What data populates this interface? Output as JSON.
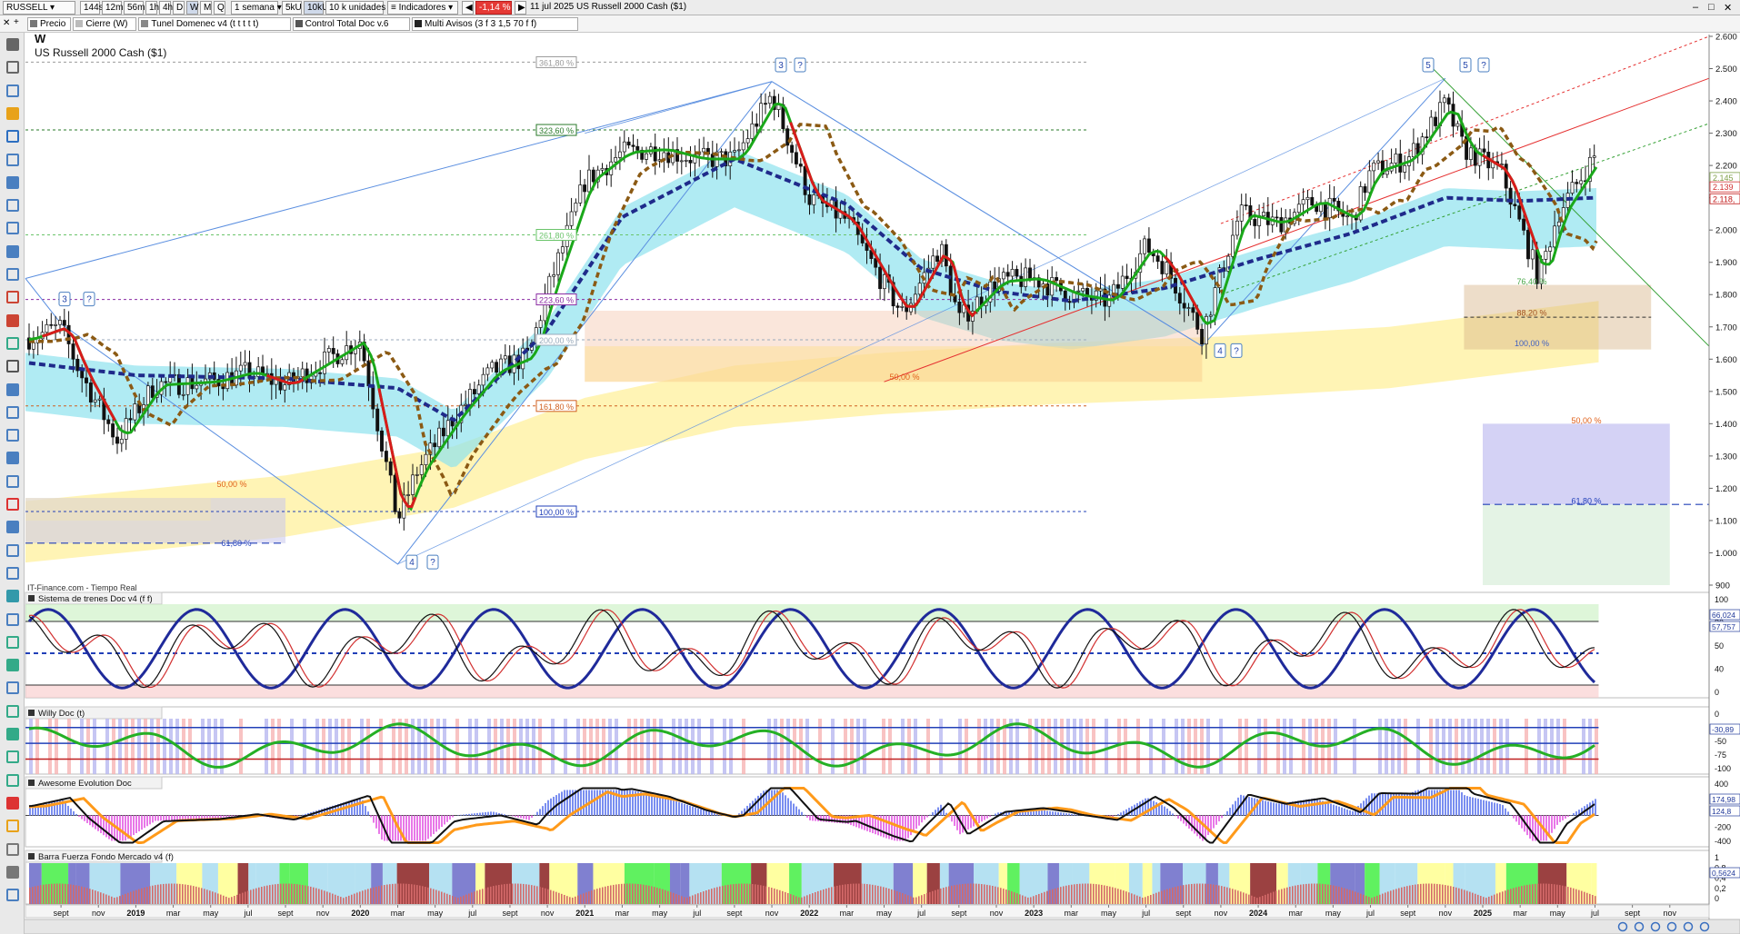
{
  "toolbar": {
    "symbol": "RUSSELL",
    "timeframes": [
      "144s",
      "12m",
      "56m",
      "1h",
      "4h",
      "D",
      "W",
      "M",
      "Q"
    ],
    "active_timeframe": "W",
    "units_buttons": [
      "5kU",
      "10kU"
    ],
    "active_units": "10kU",
    "period_select": "1 semana",
    "units_select": "10 k unidades",
    "indicators_button": "Indicadores",
    "change_badge": "-1,14 %",
    "info": "11 jul 2025  US Russell 2000 Cash ($1)"
  },
  "indicator_tabs": [
    {
      "label": "Precio",
      "color": "#777777"
    },
    {
      "label": "Cierre (W)",
      "color": "#bbbbbb"
    },
    {
      "label": "Tunel Domenec v4 (t t t t t)",
      "color": "#888888"
    },
    {
      "label": "Control Total Doc v.6",
      "color": "#555555"
    },
    {
      "label": "Multi Avisos (3 f 3 1,5 70 f f)",
      "color": "#222222"
    }
  ],
  "main": {
    "period_label": "W",
    "instrument_title": "US Russell 2000 Cash ($1)",
    "source_label": "IT-Finance.com - Tiempo Real",
    "y_ticks": [
      "2.600",
      "2.500",
      "2.400",
      "2.300",
      "2.200",
      "2.100",
      "2.000",
      "1.900",
      "1.800",
      "1.700",
      "1.600",
      "1.500",
      "1.400",
      "1.300",
      "1.200",
      "1.100",
      "1.000",
      "900"
    ],
    "price_labels": [
      "2.145",
      "2.139",
      "2.118,"
    ],
    "fib_labels": [
      "361,80 %",
      "323,60 %",
      "261,80 %",
      "223,60 %",
      "200,00 %",
      "161,80 %",
      "100,00 %",
      "50,00 %",
      "61,80 %",
      "76,40 %",
      "88,20 %",
      "100,00 %",
      "50,00 %",
      "61,80 %",
      "50,00 %"
    ],
    "wave_labels": [
      "3",
      "?",
      "3",
      "?",
      "4",
      "?",
      "5",
      "5",
      "?",
      "4",
      "?"
    ]
  },
  "x_axis_labels": [
    "sept",
    "nov",
    "2019",
    "mar",
    "may",
    "jul",
    "sept",
    "nov",
    "2020",
    "mar",
    "may",
    "jul",
    "sept",
    "nov",
    "2021",
    "mar",
    "may",
    "jul",
    "sept",
    "nov",
    "2022",
    "mar",
    "may",
    "jul",
    "sept",
    "nov",
    "2023",
    "mar",
    "may",
    "jul",
    "sept",
    "nov",
    "2024",
    "mar",
    "may",
    "jul",
    "sept",
    "nov",
    "2025",
    "mar",
    "may",
    "jul",
    "sept",
    "nov"
  ],
  "panels": [
    {
      "title": "Sistema de trenes Doc v4 (f f)",
      "ticks": [
        "100",
        "80",
        "50",
        "40",
        "0"
      ],
      "values": [
        "66,024",
        "57,757"
      ]
    },
    {
      "title": "Willy Doc (t)",
      "ticks": [
        "0",
        "-25",
        "-50",
        "-75",
        "-100"
      ],
      "values": [
        "-30,89"
      ]
    },
    {
      "title": "Awesome Evolution Doc",
      "ticks": [
        "400",
        "200",
        "0",
        "-200",
        "-400"
      ],
      "values": [
        "174,98",
        "124,8"
      ]
    },
    {
      "title": "Barra Fuerza Fondo Mercado v4 (f)",
      "ticks": [
        "1",
        "0,8",
        "0,4",
        "0,2",
        "0"
      ],
      "values": [
        "0,5624"
      ]
    }
  ],
  "colors": {
    "accent_red": "#e53935",
    "line_green": "#1aa81a",
    "line_red": "#d81b1b",
    "navy_dash": "#1f2a8a",
    "brown_dash": "#8b5a14",
    "cloud_cyan": "#8fe3ee",
    "cloud_yellow": "#fff2a8",
    "fib_blue": "#2240b8",
    "fib_green": "#228b22",
    "fib_purple": "#7a1fa2"
  },
  "chart_data": {
    "type": "candlestick",
    "title": "US Russell 2000 Cash ($1)",
    "timeframe": "W",
    "ylim": [
      900,
      2600
    ],
    "x_range": [
      "2018-07",
      "2025-12"
    ],
    "series": [
      {
        "name": "price",
        "x": [
          "2018-07",
          "2018-09",
          "2018-10",
          "2018-12",
          "2019-02",
          "2019-05",
          "2019-07",
          "2019-09",
          "2019-11",
          "2020-01",
          "2020-03",
          "2020-04",
          "2020-06",
          "2020-08",
          "2020-10",
          "2020-11",
          "2021-01",
          "2021-03",
          "2021-05",
          "2021-07",
          "2021-09",
          "2021-11",
          "2022-01",
          "2022-03",
          "2022-05",
          "2022-06",
          "2022-08",
          "2022-09",
          "2022-11",
          "2023-01",
          "2023-03",
          "2023-05",
          "2023-07",
          "2023-08",
          "2023-10",
          "2023-12",
          "2024-02",
          "2024-04",
          "2024-06",
          "2024-07",
          "2024-09",
          "2024-11",
          "2024-12",
          "2025-02",
          "2025-04",
          "2025-05",
          "2025-07"
        ],
        "y": [
          1660,
          1700,
          1560,
          1350,
          1520,
          1530,
          1560,
          1520,
          1590,
          1660,
          1100,
          1250,
          1420,
          1560,
          1610,
          1810,
          2150,
          2240,
          2250,
          2220,
          2220,
          2420,
          2100,
          2030,
          1830,
          1740,
          1950,
          1720,
          1840,
          1850,
          1800,
          1780,
          1950,
          1890,
          1680,
          2050,
          2020,
          2090,
          2030,
          2180,
          2220,
          2390,
          2250,
          2180,
          1850,
          2050,
          2230
        ]
      },
      {
        "name": "tunnel",
        "x": [
          "2018-07",
          "2019-01",
          "2019-09",
          "2020-03",
          "2020-06",
          "2020-11",
          "2021-03",
          "2021-09",
          "2022-03",
          "2022-07",
          "2022-11",
          "2023-03",
          "2023-08",
          "2024-01",
          "2024-06",
          "2024-11",
          "2025-03",
          "2025-07"
        ],
        "y": [
          1600,
          1560,
          1550,
          1520,
          1420,
          1700,
          2050,
          2230,
          2090,
          1890,
          1820,
          1790,
          1830,
          1920,
          2000,
          2110,
          2100,
          2110
        ]
      }
    ],
    "annotations": [
      "3",
      "?",
      "4",
      "5",
      "361,80 %",
      "323,60 %",
      "261,80 %",
      "223,60 %",
      "200,00 %",
      "161,80 %",
      "100,00 %",
      "50,00 %",
      "61,80 %",
      "76,40 %",
      "88,20 %"
    ]
  }
}
